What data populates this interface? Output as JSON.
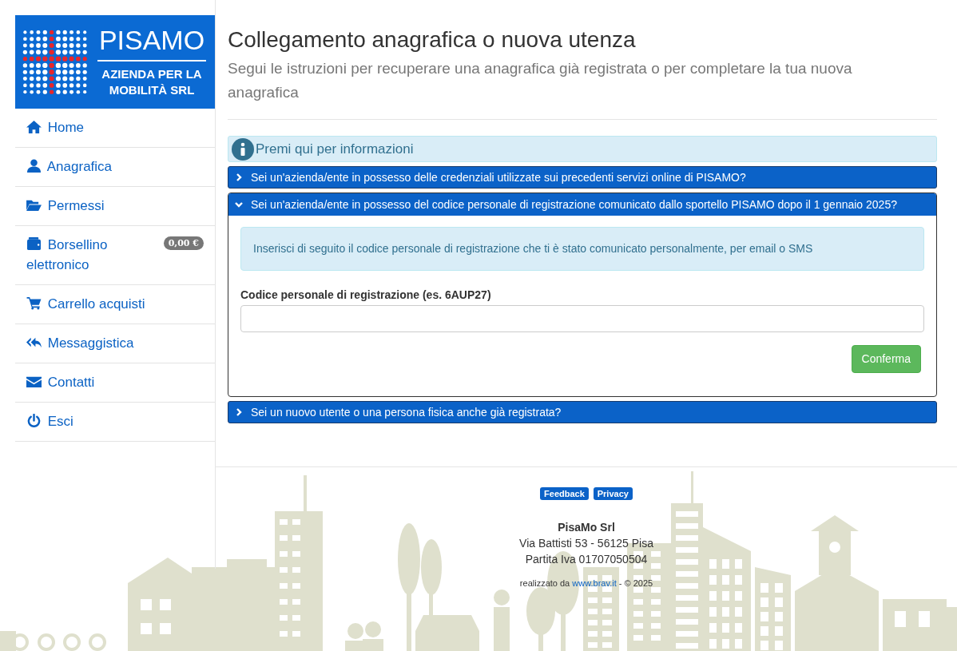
{
  "logo": {
    "title": "PISAMO",
    "subtitle": "AZIENDA PER LA MOBILITÀ SRL"
  },
  "sidebar": {
    "items": [
      {
        "label": "Home"
      },
      {
        "label": "Anagrafica"
      },
      {
        "label": "Permessi"
      },
      {
        "label": "Borsellino elettronico",
        "badge": "0,00 €"
      },
      {
        "label": "Carrello acquisti"
      },
      {
        "label": "Messaggistica"
      },
      {
        "label": "Contatti"
      },
      {
        "label": "Esci"
      }
    ]
  },
  "page": {
    "title": "Collegamento anagrafica o nuova utenza",
    "subtitle": "Segui le istruzioni per recuperare una anagrafica già registrata o per completare la tua nuova anagrafica"
  },
  "info_bar": {
    "label": "Premi qui per informazioni"
  },
  "accordion": [
    {
      "title": "Sei un'azienda/ente in possesso delle credenziali utilizzate sui precedenti servizi online di PISAMO?",
      "expanded": false
    },
    {
      "title": "Sei un'azienda/ente in possesso del codice personale di registrazione comunicato dallo sportello PISAMO dopo il 1 gennaio 2025?",
      "expanded": true,
      "body": {
        "alert": "Inserisci di seguito il codice personale di registrazione che ti è stato comunicato personalmente, per email o SMS",
        "field_label": "Codice personale di registrazione (es. 6AUP27)",
        "button": "Conferma"
      }
    },
    {
      "title": "Sei un nuovo utente o una persona fisica anche già registrata?",
      "expanded": false
    }
  ],
  "footer": {
    "links": [
      "Feedback",
      "Privacy"
    ],
    "company": "PisaMo Srl",
    "address": "Via Battisti 53 - 56125 Pisa",
    "vat": "Partita Iva 01707050504",
    "credit_prefix": "realizzato da",
    "credit_link": "www.brav.it",
    "credit_suffix": "- © 2025"
  }
}
